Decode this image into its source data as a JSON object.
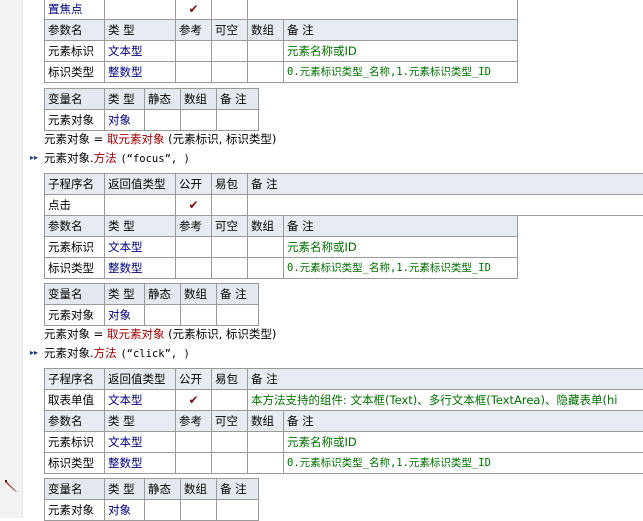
{
  "section1": {
    "sub_row": {
      "name": "置焦点",
      "check": "✔"
    },
    "param_header": [
      "参数名",
      "类 型",
      "参考",
      "可空",
      "数组",
      "备 注"
    ],
    "params": [
      {
        "name": "元素标识",
        "type": "文本型",
        "note": "元素名称或ID"
      },
      {
        "name": "标识类型",
        "type": "整数型",
        "note": "0.元素标识类型_名称,1.元素标识类型_ID"
      }
    ],
    "var_header": [
      "变量名",
      "类 型",
      "静态",
      "数组",
      "备 注"
    ],
    "var_row": {
      "name": "元素对象",
      "type": "对象"
    },
    "code1": {
      "lhs": "元素对象",
      "eq": "=",
      "func": "取元素对象",
      "args": "(元素标识, 标识类型)"
    },
    "code2": {
      "obj": "元素对象.",
      "method": "方法",
      "args": "(“focus”, )"
    }
  },
  "section2": {
    "sub_header": [
      "子程序名",
      "返回值类型",
      "公开",
      "易包",
      "备 注"
    ],
    "sub_row": {
      "name": "点击",
      "check": "✔"
    },
    "param_header": [
      "参数名",
      "类 型",
      "参考",
      "可空",
      "数组",
      "备 注"
    ],
    "params": [
      {
        "name": "元素标识",
        "type": "文本型",
        "note": "元素名称或ID"
      },
      {
        "name": "标识类型",
        "type": "整数型",
        "note": "0.元素标识类型_名称,1.元素标识类型_ID"
      }
    ],
    "var_header": [
      "变量名",
      "类 型",
      "静态",
      "数组",
      "备 注"
    ],
    "var_row": {
      "name": "元素对象",
      "type": "对象"
    },
    "code1": {
      "lhs": "元素对象",
      "eq": "=",
      "func": "取元素对象",
      "args": "(元素标识, 标识类型)"
    },
    "code2": {
      "obj": "元素对象.",
      "method": "方法",
      "args": "(“click”, )"
    }
  },
  "section3": {
    "sub_header": [
      "子程序名",
      "返回值类型",
      "公开",
      "易包",
      "备 注"
    ],
    "sub_row": {
      "name": "取表单值",
      "ret": "文本型",
      "check": "✔",
      "note": "本方法支持的组件: 文本框(Text)、多行文本框(TextArea)、隐藏表单(hi"
    },
    "param_header": [
      "参数名",
      "类 型",
      "参考",
      "可空",
      "数组",
      "备 注"
    ],
    "params": [
      {
        "name": "元素标识",
        "type": "文本型",
        "note": "元素名称或ID"
      },
      {
        "name": "标识类型",
        "type": "整数型",
        "note": "0.元素标识类型_名称,1.元素标识类型_ID"
      }
    ],
    "var_header": [
      "变量名",
      "类 型",
      "静态",
      "数组",
      "备 注"
    ],
    "var_row": {
      "name": "元素对象",
      "type": "对象"
    }
  },
  "icons": {
    "arrow": "▸▸",
    "pencil": "pencil-icon"
  }
}
